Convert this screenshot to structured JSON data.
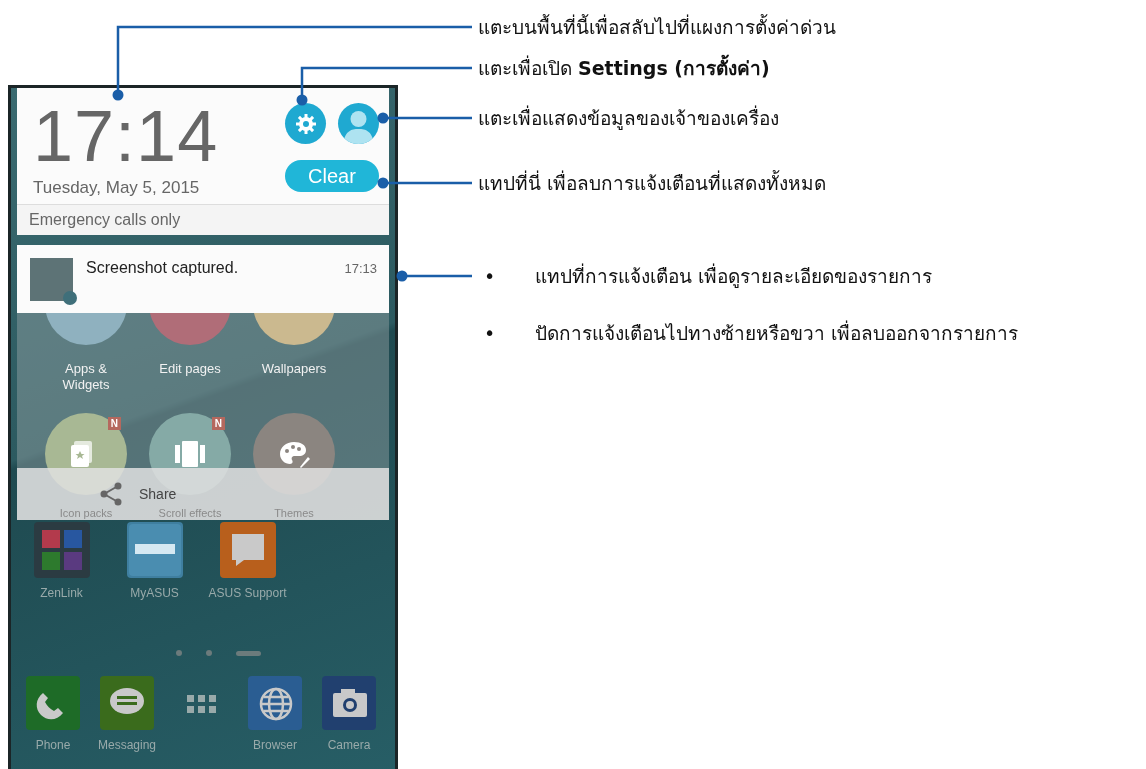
{
  "phone": {
    "quick_panel": {
      "time": "17:14",
      "date": "Tuesday, May 5, 2015",
      "clear_button": "Clear"
    },
    "status": "Emergency calls only",
    "notification": {
      "title": "Screenshot captured.",
      "time": "17:13"
    },
    "menu": {
      "items": [
        {
          "label": "Apps & Widgets",
          "kind": "apps"
        },
        {
          "label": "Edit pages",
          "kind": "edit"
        },
        {
          "label": "Wallpapers",
          "kind": "wallpapers"
        },
        {
          "label": "Icon packs",
          "kind": "icon-packs",
          "badge": "N"
        },
        {
          "label": "Scroll effects",
          "kind": "scroll-effects",
          "badge": "N"
        },
        {
          "label": "Themes",
          "kind": "themes"
        }
      ],
      "share": "Share"
    },
    "home_apps": [
      {
        "label": "ZenLink",
        "kind": "folder"
      },
      {
        "label": "MyASUS",
        "kind": "myasus"
      },
      {
        "label": "ASUS Support",
        "kind": "support"
      }
    ],
    "page_indicator": [
      {
        "selected": false
      },
      {
        "selected": false
      },
      {
        "selected": true
      }
    ],
    "dock": [
      {
        "label": "Phone",
        "kind": "phone"
      },
      {
        "label": "Messaging",
        "kind": "messaging"
      },
      {
        "kind": "app-grid"
      },
      {
        "label": "Browser",
        "kind": "browser"
      },
      {
        "label": "Camera",
        "kind": "camera"
      }
    ]
  },
  "callouts": [
    {
      "text": "แตะบนพื้นที่นี้เพื่อสลับไปที่แผงการตั้งค่าด่วน"
    },
    {
      "text": "แตะเพื่อเปิด **Settings (การตั้งค่า)**"
    },
    {
      "text": "แตะเพื่อแสดงข้อมูลของเจ้าของเครื่อง"
    },
    {
      "text": "แทปที่นี่ เพื่อลบการแจ้งเตือนที่แสดงทั้งหมด"
    }
  ],
  "notification_callout": {
    "bullets": [
      {
        "mark": "•",
        "text": "แทปที่การแจ้งเตือน เพื่อดูรายละเอียดของรายการ"
      },
      {
        "mark": "•",
        "text": "ปัดการแจ้งเตือนไปทางซ้ายหรือขวา เพื่อลบออกจากรายการ"
      }
    ]
  }
}
